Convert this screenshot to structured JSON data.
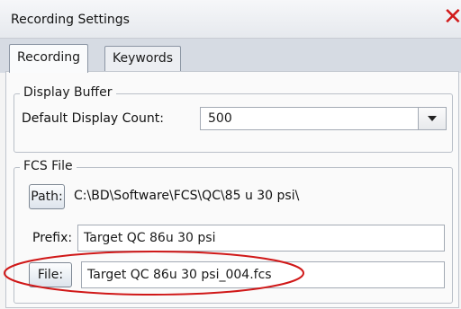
{
  "window": {
    "title": "Recording Settings"
  },
  "tabs": [
    {
      "label": "Recording",
      "active": true
    },
    {
      "label": "Keywords",
      "active": false
    }
  ],
  "display_buffer": {
    "legend": "Display Buffer",
    "count_label": "Default Display Count:",
    "count_value": "500"
  },
  "fcs_file": {
    "legend": "FCS File",
    "path_button": "Path:",
    "path_value": "C:\\BD\\Software\\FCS\\QC\\85 u 30 psi\\",
    "prefix_label": "Prefix:",
    "prefix_value": "Target QC 86u 30 psi",
    "file_button": "File:",
    "file_value": "Target QC 86u 30 psi_004.fcs"
  },
  "colors": {
    "close": "#d11a1a",
    "annotation": "#d01818"
  },
  "icons": {
    "close": "close-icon",
    "dropdown": "chevron-down-icon"
  }
}
